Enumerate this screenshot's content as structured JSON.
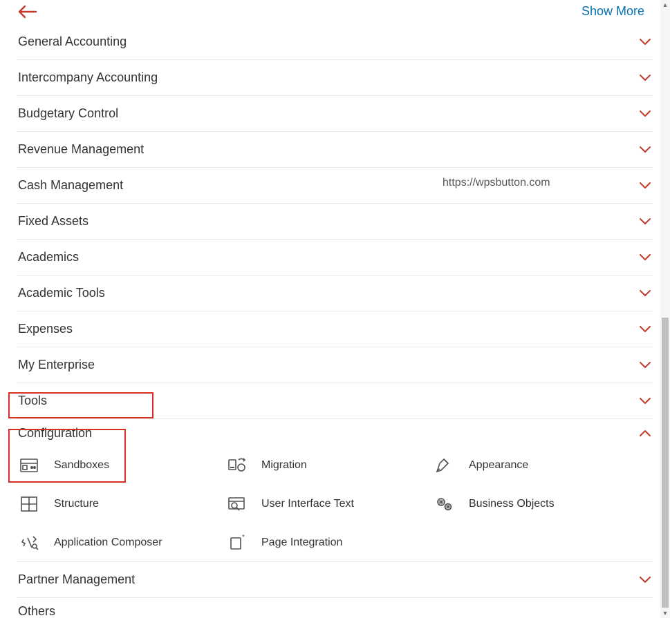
{
  "header": {
    "show_more_label": "Show More"
  },
  "watermark": "https://wpsbutton.com",
  "sections": [
    {
      "label": "General Accounting"
    },
    {
      "label": "Intercompany Accounting"
    },
    {
      "label": "Budgetary Control"
    },
    {
      "label": "Revenue Management"
    },
    {
      "label": "Cash Management"
    },
    {
      "label": "Fixed Assets"
    },
    {
      "label": "Academics"
    },
    {
      "label": "Academic Tools"
    },
    {
      "label": "Expenses"
    },
    {
      "label": "My Enterprise"
    },
    {
      "label": "Tools"
    },
    {
      "label": "Configuration"
    },
    {
      "label": "Partner Management"
    },
    {
      "label": "Others"
    }
  ],
  "configuration_items": [
    {
      "label": "Sandboxes",
      "icon": "sandbox-icon"
    },
    {
      "label": "Migration",
      "icon": "migration-icon"
    },
    {
      "label": "Appearance",
      "icon": "appearance-icon"
    },
    {
      "label": "Structure",
      "icon": "structure-icon"
    },
    {
      "label": "User Interface Text",
      "icon": "ui-text-icon"
    },
    {
      "label": "Business Objects",
      "icon": "business-objects-icon"
    },
    {
      "label": "Application Composer",
      "icon": "app-composer-icon"
    },
    {
      "label": "Page Integration",
      "icon": "page-integration-icon"
    }
  ]
}
